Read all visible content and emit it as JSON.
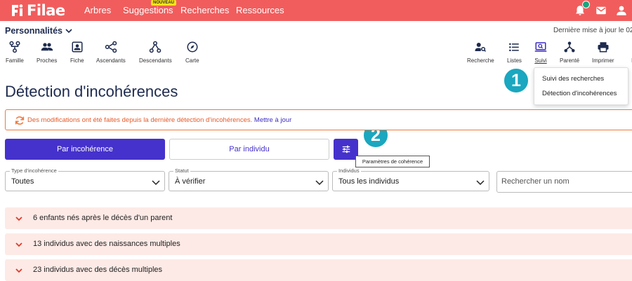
{
  "app": {
    "logo_text": "Filae",
    "nav": [
      {
        "label": "Arbres"
      },
      {
        "label": "Suggestions",
        "badge": "NOUVEAU"
      },
      {
        "label": "Recherches"
      },
      {
        "label": "Ressources"
      }
    ],
    "top_icons": [
      "bell-icon",
      "mail-icon",
      "user-icon"
    ]
  },
  "subheader": {
    "persona": "Personnalités",
    "last_update": "Dernière mise à jour le 02/0"
  },
  "toolbar_left": [
    {
      "label": "Famille",
      "icon": "family-tree-icon"
    },
    {
      "label": "Proches",
      "icon": "people-icon"
    },
    {
      "label": "Fiche",
      "icon": "person-card-icon"
    },
    {
      "label": "Ascendants",
      "icon": "ascendants-icon"
    },
    {
      "label": "Descendants",
      "icon": "descendants-icon"
    },
    {
      "label": "Carte",
      "icon": "compass-icon"
    }
  ],
  "toolbar_right": [
    {
      "label": "Recherche",
      "icon": "person-search-icon"
    },
    {
      "label": "Listes",
      "icon": "list-icon"
    },
    {
      "label": "Suivi",
      "icon": "monitor-search-icon",
      "active": true
    },
    {
      "label": "Parenté",
      "icon": "kinship-icon"
    },
    {
      "label": "Imprimer",
      "icon": "printer-icon"
    },
    {
      "label": "R",
      "icon": ""
    }
  ],
  "page": {
    "title": "Détection d'incohérences"
  },
  "dropdown_menu": {
    "items": [
      "Suivi des recherches",
      "Détection d'incohérences"
    ]
  },
  "steps": [
    "1",
    "2"
  ],
  "alert": {
    "message": "Des modifications ont été faites depuis la dernière détection d'incohérences.",
    "link": "Mettre à jour"
  },
  "tabs": [
    {
      "label": "Par incohérence",
      "active": true
    },
    {
      "label": "Par individu",
      "active": false
    }
  ],
  "settings_tooltip": "Paramètres de cohérence",
  "filters": [
    {
      "label": "Type d'incohérence",
      "value": "Toutes"
    },
    {
      "label": "Statut",
      "value": "À vérifier"
    },
    {
      "label": "Individus",
      "value": "Tous les individus"
    }
  ],
  "search": {
    "placeholder": "Rechercher un nom"
  },
  "accordion": [
    "6 enfants nés après le décès d'un parent",
    "13 individus avec des naissances multiples",
    "23 individus avec des décès multiples"
  ],
  "colors": {
    "topbar": "#f15d5d",
    "primary": "#4531cc",
    "alert": "#f0793d",
    "step_marker": "#1aa7bf",
    "accordion_bg": "#fdeae6",
    "notification_dot": "#1aa57f",
    "badge": "#f7e31a"
  }
}
